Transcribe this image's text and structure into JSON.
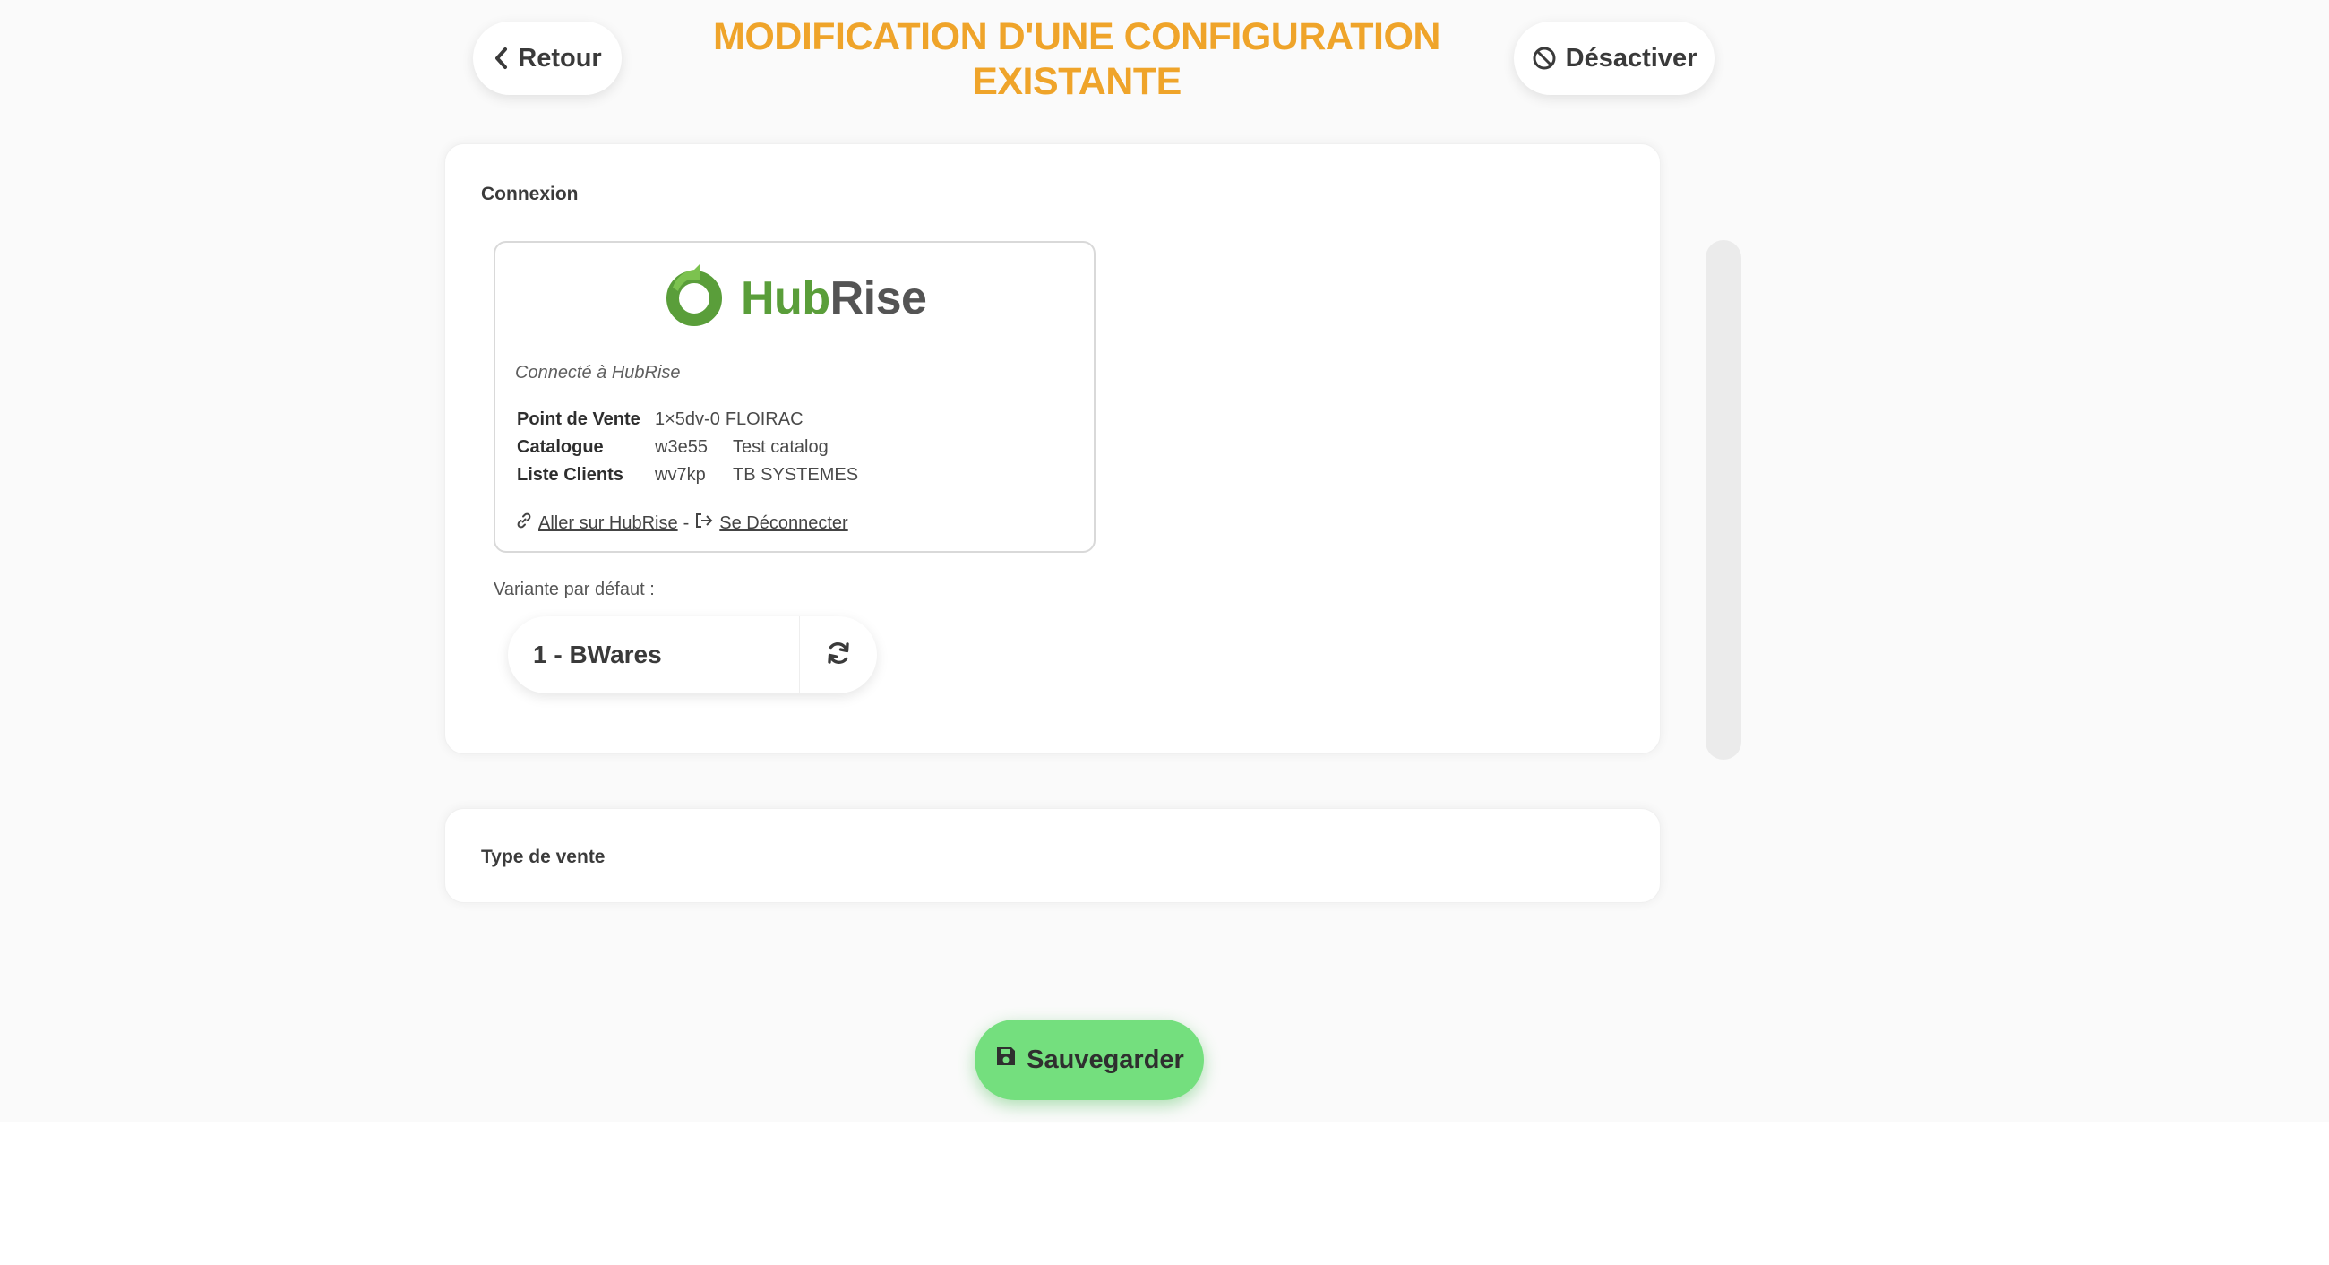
{
  "header": {
    "back_label": "Retour",
    "title": "MODIFICATION D'UNE CONFIGURATION EXISTANTE",
    "deactivate_label": "Désactiver",
    "title_color": "#efa42a"
  },
  "connexion": {
    "section_title": "Connexion",
    "provider": {
      "logo_text_part1": "Hub",
      "logo_text_part2": "Rise",
      "status_text": "Connecté à HubRise",
      "rows": [
        {
          "label": "Point de Vente",
          "id": "1×5dv-0",
          "name": "FLOIRAC"
        },
        {
          "label": "Catalogue",
          "id": "w3e55",
          "name": "Test catalog"
        },
        {
          "label": "Liste Clients",
          "id": "wv7kp",
          "name": "TB SYSTEMES"
        }
      ],
      "link_goto": "Aller sur HubRise",
      "link_separator": "-",
      "link_disconnect": "Se Déconnecter"
    },
    "variant_label": "Variante par défaut :",
    "variant_value": "1 - BWares"
  },
  "type_vente": {
    "section_title": "Type de vente"
  },
  "footer": {
    "save_label": "Sauvegarder",
    "save_color": "#74df7e"
  },
  "icons": [
    "chevron-left-icon",
    "ban-icon",
    "hubrise-logo-icon",
    "link-icon",
    "sign-out-icon",
    "refresh-icon",
    "floppy-disk-icon"
  ]
}
